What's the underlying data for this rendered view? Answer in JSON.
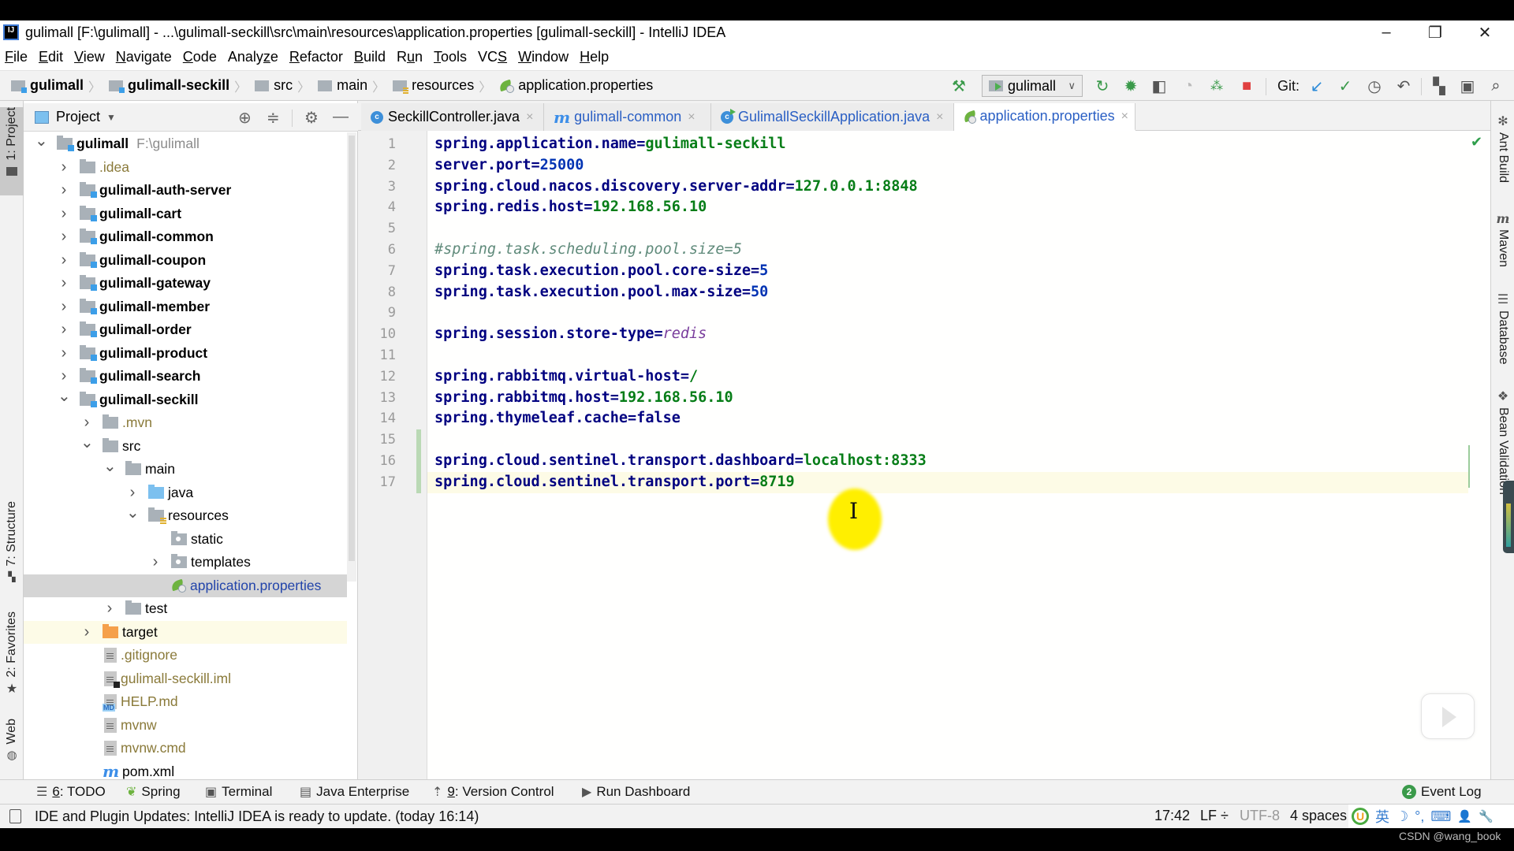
{
  "window": {
    "title": "gulimall [F:\\gulimall] - ...\\gulimall-seckill\\src\\main\\resources\\application.properties [gulimall-seckill] - IntelliJ IDEA",
    "logo": "IJ",
    "controls": {
      "minimize": "–",
      "restore": "❐",
      "close": "✕"
    }
  },
  "menu": [
    {
      "label": "File",
      "mnemonic": "F",
      "rest": "ile"
    },
    {
      "label": "Edit",
      "mnemonic": "E",
      "rest": "dit"
    },
    {
      "label": "View",
      "mnemonic": "V",
      "rest": "iew"
    },
    {
      "label": "Navigate",
      "mnemonic": "N",
      "rest": "avigate"
    },
    {
      "label": "Code",
      "mnemonic": "C",
      "rest": "ode"
    },
    {
      "label": "Analyze",
      "pre": "Analy",
      "mnemonic": "z",
      "rest": "e"
    },
    {
      "label": "Refactor",
      "mnemonic": "R",
      "rest": "efactor"
    },
    {
      "label": "Build",
      "mnemonic": "B",
      "rest": "uild"
    },
    {
      "label": "Run",
      "pre": "R",
      "mnemonic": "u",
      "rest": "n"
    },
    {
      "label": "Tools",
      "mnemonic": "T",
      "rest": "ools"
    },
    {
      "label": "VCS",
      "pre": "VC",
      "mnemonic": "S",
      "rest": ""
    },
    {
      "label": "Window",
      "mnemonic": "W",
      "rest": "indow"
    },
    {
      "label": "Help",
      "mnemonic": "H",
      "rest": "elp"
    }
  ],
  "breadcrumb": [
    "gulimall",
    "gulimall-seckill",
    "src",
    "main",
    "resources",
    "application.properties"
  ],
  "toolbar": {
    "run_config": "gulimall",
    "git_label": "Git:",
    "icons": [
      "build-hammer-icon",
      "rerun-icon",
      "debug-icon",
      "run-with-coverage-icon",
      "profile-icon",
      "attach-debugger-icon",
      "stop-icon",
      "git-update-icon",
      "git-commit-icon",
      "git-history-icon",
      "git-rollback-icon",
      "project-structure-icon",
      "run-anything-icon",
      "search-everywhere-icon"
    ]
  },
  "left_strip": {
    "project": "1: Project",
    "structure": "7: Structure",
    "favorites": "2: Favorites",
    "web": "Web"
  },
  "project_panel": {
    "title": "Project",
    "tree": [
      {
        "name": "gulimall",
        "path": "F:\\gulimall",
        "depth": 0,
        "arrow": "open",
        "icon": "module",
        "style": "bold"
      },
      {
        "name": ".idea",
        "depth": 1,
        "arrow": "closed",
        "icon": "folder",
        "style": "excluded"
      },
      {
        "name": "gulimall-auth-server",
        "depth": 1,
        "arrow": "closed",
        "icon": "module",
        "style": "bold"
      },
      {
        "name": "gulimall-cart",
        "depth": 1,
        "arrow": "closed",
        "icon": "module",
        "style": "bold"
      },
      {
        "name": "gulimall-common",
        "depth": 1,
        "arrow": "closed",
        "icon": "module",
        "style": "bold"
      },
      {
        "name": "gulimall-coupon",
        "depth": 1,
        "arrow": "closed",
        "icon": "module",
        "style": "bold"
      },
      {
        "name": "gulimall-gateway",
        "depth": 1,
        "arrow": "closed",
        "icon": "module",
        "style": "bold"
      },
      {
        "name": "gulimall-member",
        "depth": 1,
        "arrow": "closed",
        "icon": "module",
        "style": "bold"
      },
      {
        "name": "gulimall-order",
        "depth": 1,
        "arrow": "closed",
        "icon": "module",
        "style": "bold"
      },
      {
        "name": "gulimall-product",
        "depth": 1,
        "arrow": "closed",
        "icon": "module",
        "style": "bold"
      },
      {
        "name": "gulimall-search",
        "depth": 1,
        "arrow": "closed",
        "icon": "module",
        "style": "bold"
      },
      {
        "name": "gulimall-seckill",
        "depth": 1,
        "arrow": "open",
        "icon": "module",
        "style": "bold"
      },
      {
        "name": ".mvn",
        "depth": 2,
        "arrow": "closed",
        "icon": "folder",
        "style": "excluded"
      },
      {
        "name": "src",
        "depth": 2,
        "arrow": "open",
        "icon": "folder",
        "style": "normal"
      },
      {
        "name": "main",
        "depth": 3,
        "arrow": "open",
        "icon": "folder",
        "style": "normal"
      },
      {
        "name": "java",
        "depth": 4,
        "arrow": "closed",
        "icon": "source-folder",
        "style": "normal"
      },
      {
        "name": "resources",
        "depth": 4,
        "arrow": "open",
        "icon": "resources-folder",
        "style": "normal"
      },
      {
        "name": "static",
        "depth": 5,
        "arrow": "none",
        "icon": "web-folder",
        "style": "normal"
      },
      {
        "name": "templates",
        "depth": 5,
        "arrow": "closed",
        "icon": "web-folder",
        "style": "normal"
      },
      {
        "name": "application.properties",
        "depth": 5,
        "arrow": "none",
        "icon": "spring-properties",
        "style": "selected"
      },
      {
        "name": "test",
        "depth": 3,
        "arrow": "closed",
        "icon": "folder",
        "style": "normal"
      },
      {
        "name": "target",
        "depth": 2,
        "arrow": "closed",
        "icon": "target-folder",
        "style": "target"
      },
      {
        "name": ".gitignore",
        "depth": 2,
        "arrow": "none",
        "icon": "text-file",
        "style": "ignored"
      },
      {
        "name": "gulimall-seckill.iml",
        "depth": 2,
        "arrow": "none",
        "icon": "iml-file",
        "style": "ignored"
      },
      {
        "name": "HELP.md",
        "depth": 2,
        "arrow": "none",
        "icon": "md-file",
        "style": "ignored"
      },
      {
        "name": "mvnw",
        "depth": 2,
        "arrow": "none",
        "icon": "text-file",
        "style": "ignored"
      },
      {
        "name": "mvnw.cmd",
        "depth": 2,
        "arrow": "none",
        "icon": "text-file",
        "style": "ignored"
      },
      {
        "name": "pom.xml",
        "depth": 2,
        "arrow": "none",
        "icon": "maven-file",
        "style": "normal"
      }
    ]
  },
  "tabs": [
    {
      "label": "SeckillController.java",
      "icon": "java-class",
      "active": false
    },
    {
      "label": "gulimall-common",
      "icon": "maven",
      "active": false
    },
    {
      "label": "GulimallSeckillApplication.java",
      "icon": "java-class-run",
      "active": false
    },
    {
      "label": "application.properties",
      "icon": "spring-properties",
      "active": true
    }
  ],
  "editor": {
    "current_line": 17,
    "lines": [
      {
        "n": 1,
        "key": "spring.application.name",
        "value": "gulimall-seckill",
        "vtype": "str"
      },
      {
        "n": 2,
        "key": "server.port",
        "value": "25000",
        "vtype": "num"
      },
      {
        "n": 3,
        "key": "spring.cloud.nacos.discovery.server-addr",
        "value": "127.0.0.1:8848",
        "vtype": "str"
      },
      {
        "n": 4,
        "key": "spring.redis.host",
        "value": "192.168.56.10",
        "vtype": "str"
      },
      {
        "n": 5,
        "key": "",
        "value": "",
        "vtype": "empty"
      },
      {
        "n": 6,
        "comment": "#spring.task.scheduling.pool.size=5",
        "vtype": "comment"
      },
      {
        "n": 7,
        "key": "spring.task.execution.pool.core-size",
        "value": "5",
        "vtype": "num"
      },
      {
        "n": 8,
        "key": "spring.task.execution.pool.max-size",
        "value": "50",
        "vtype": "num"
      },
      {
        "n": 9,
        "key": "",
        "value": "",
        "vtype": "empty"
      },
      {
        "n": 10,
        "key": "spring.session.store-type",
        "value": "redis",
        "vtype": "enum"
      },
      {
        "n": 11,
        "key": "",
        "value": "",
        "vtype": "empty"
      },
      {
        "n": 12,
        "key": "spring.rabbitmq.virtual-host",
        "value": "/",
        "vtype": "str"
      },
      {
        "n": 13,
        "key": "spring.rabbitmq.host",
        "value": "192.168.56.10",
        "vtype": "str"
      },
      {
        "n": 14,
        "key": "spring.thymeleaf.cache",
        "value": "false",
        "vtype": "kw"
      },
      {
        "n": 15,
        "key": "",
        "value": "",
        "vtype": "empty"
      },
      {
        "n": 16,
        "key": "spring.cloud.sentinel.transport.dashboard",
        "value": "localhost:8333",
        "vtype": "str"
      },
      {
        "n": 17,
        "key": "spring.cloud.sentinel.transport.port",
        "value": "8719",
        "vtype": "str"
      }
    ]
  },
  "right_strip": [
    "Ant Build",
    "Maven",
    "Database",
    "Bean Validation"
  ],
  "bottom_tools": [
    {
      "label": "6: TODO",
      "mn": "6",
      "rest": ": TODO",
      "icon": "todo-list-icon"
    },
    {
      "label": "Spring",
      "icon": "spring-leaf-icon"
    },
    {
      "label": "Terminal",
      "icon": "terminal-icon"
    },
    {
      "label": "Java Enterprise",
      "icon": "java-enterprise-icon"
    },
    {
      "label": "9: Version Control",
      "mn": "9",
      "rest": ": Version Control",
      "icon": "version-control-icon"
    },
    {
      "label": "Run Dashboard",
      "icon": "run-dashboard-icon"
    }
  ],
  "event_log": {
    "label": "Event Log",
    "count": "2"
  },
  "status": {
    "message": "IDE and Plugin Updates: IntelliJ IDEA is ready to update. (today 16:14)",
    "position": "17:42",
    "line_sep": "LF ÷",
    "encoding": "UTF-8",
    "indent": "4 spaces"
  },
  "ime": {
    "lang": "英",
    "moon": "☽",
    "punct": "°,",
    "keyboard": "⌨",
    "user": "👤",
    "tool": "🔧"
  },
  "watermark": "CSDN @wang_book",
  "colors": {
    "key": "#000080",
    "string": "#067d17",
    "number": "#0033b3",
    "comment": "#5f8a7a",
    "enum": "#7a3e9d"
  }
}
